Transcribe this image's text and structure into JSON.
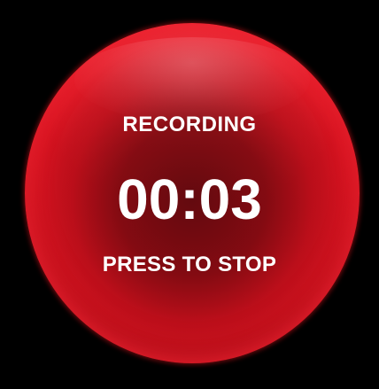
{
  "recorder": {
    "status": "RECORDING",
    "elapsed": "00:03",
    "hint": "PRESS TO STOP"
  },
  "colors": {
    "background": "#000000",
    "button_red": "#e0121f",
    "text": "#ffffff"
  }
}
